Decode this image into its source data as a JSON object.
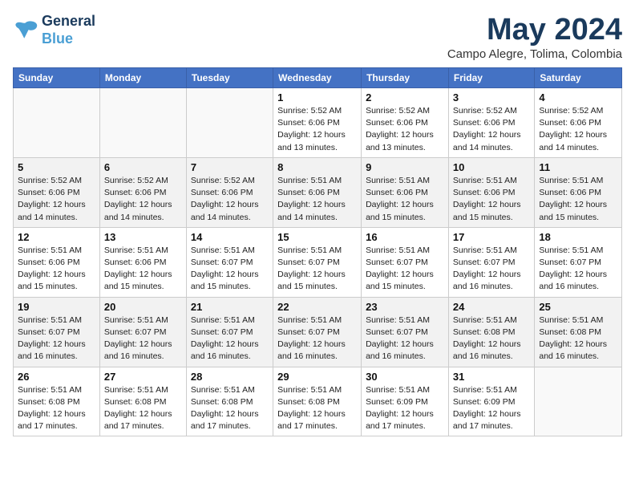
{
  "header": {
    "logo_line1": "General",
    "logo_line2": "Blue",
    "month_title": "May 2024",
    "location": "Campo Alegre, Tolima, Colombia"
  },
  "weekdays": [
    "Sunday",
    "Monday",
    "Tuesday",
    "Wednesday",
    "Thursday",
    "Friday",
    "Saturday"
  ],
  "weeks": [
    [
      {
        "day": "",
        "info": ""
      },
      {
        "day": "",
        "info": ""
      },
      {
        "day": "",
        "info": ""
      },
      {
        "day": "1",
        "info": "Sunrise: 5:52 AM\nSunset: 6:06 PM\nDaylight: 12 hours\nand 13 minutes."
      },
      {
        "day": "2",
        "info": "Sunrise: 5:52 AM\nSunset: 6:06 PM\nDaylight: 12 hours\nand 13 minutes."
      },
      {
        "day": "3",
        "info": "Sunrise: 5:52 AM\nSunset: 6:06 PM\nDaylight: 12 hours\nand 14 minutes."
      },
      {
        "day": "4",
        "info": "Sunrise: 5:52 AM\nSunset: 6:06 PM\nDaylight: 12 hours\nand 14 minutes."
      }
    ],
    [
      {
        "day": "5",
        "info": "Sunrise: 5:52 AM\nSunset: 6:06 PM\nDaylight: 12 hours\nand 14 minutes."
      },
      {
        "day": "6",
        "info": "Sunrise: 5:52 AM\nSunset: 6:06 PM\nDaylight: 12 hours\nand 14 minutes."
      },
      {
        "day": "7",
        "info": "Sunrise: 5:52 AM\nSunset: 6:06 PM\nDaylight: 12 hours\nand 14 minutes."
      },
      {
        "day": "8",
        "info": "Sunrise: 5:51 AM\nSunset: 6:06 PM\nDaylight: 12 hours\nand 14 minutes."
      },
      {
        "day": "9",
        "info": "Sunrise: 5:51 AM\nSunset: 6:06 PM\nDaylight: 12 hours\nand 15 minutes."
      },
      {
        "day": "10",
        "info": "Sunrise: 5:51 AM\nSunset: 6:06 PM\nDaylight: 12 hours\nand 15 minutes."
      },
      {
        "day": "11",
        "info": "Sunrise: 5:51 AM\nSunset: 6:06 PM\nDaylight: 12 hours\nand 15 minutes."
      }
    ],
    [
      {
        "day": "12",
        "info": "Sunrise: 5:51 AM\nSunset: 6:06 PM\nDaylight: 12 hours\nand 15 minutes."
      },
      {
        "day": "13",
        "info": "Sunrise: 5:51 AM\nSunset: 6:06 PM\nDaylight: 12 hours\nand 15 minutes."
      },
      {
        "day": "14",
        "info": "Sunrise: 5:51 AM\nSunset: 6:07 PM\nDaylight: 12 hours\nand 15 minutes."
      },
      {
        "day": "15",
        "info": "Sunrise: 5:51 AM\nSunset: 6:07 PM\nDaylight: 12 hours\nand 15 minutes."
      },
      {
        "day": "16",
        "info": "Sunrise: 5:51 AM\nSunset: 6:07 PM\nDaylight: 12 hours\nand 15 minutes."
      },
      {
        "day": "17",
        "info": "Sunrise: 5:51 AM\nSunset: 6:07 PM\nDaylight: 12 hours\nand 16 minutes."
      },
      {
        "day": "18",
        "info": "Sunrise: 5:51 AM\nSunset: 6:07 PM\nDaylight: 12 hours\nand 16 minutes."
      }
    ],
    [
      {
        "day": "19",
        "info": "Sunrise: 5:51 AM\nSunset: 6:07 PM\nDaylight: 12 hours\nand 16 minutes."
      },
      {
        "day": "20",
        "info": "Sunrise: 5:51 AM\nSunset: 6:07 PM\nDaylight: 12 hours\nand 16 minutes."
      },
      {
        "day": "21",
        "info": "Sunrise: 5:51 AM\nSunset: 6:07 PM\nDaylight: 12 hours\nand 16 minutes."
      },
      {
        "day": "22",
        "info": "Sunrise: 5:51 AM\nSunset: 6:07 PM\nDaylight: 12 hours\nand 16 minutes."
      },
      {
        "day": "23",
        "info": "Sunrise: 5:51 AM\nSunset: 6:07 PM\nDaylight: 12 hours\nand 16 minutes."
      },
      {
        "day": "24",
        "info": "Sunrise: 5:51 AM\nSunset: 6:08 PM\nDaylight: 12 hours\nand 16 minutes."
      },
      {
        "day": "25",
        "info": "Sunrise: 5:51 AM\nSunset: 6:08 PM\nDaylight: 12 hours\nand 16 minutes."
      }
    ],
    [
      {
        "day": "26",
        "info": "Sunrise: 5:51 AM\nSunset: 6:08 PM\nDaylight: 12 hours\nand 17 minutes."
      },
      {
        "day": "27",
        "info": "Sunrise: 5:51 AM\nSunset: 6:08 PM\nDaylight: 12 hours\nand 17 minutes."
      },
      {
        "day": "28",
        "info": "Sunrise: 5:51 AM\nSunset: 6:08 PM\nDaylight: 12 hours\nand 17 minutes."
      },
      {
        "day": "29",
        "info": "Sunrise: 5:51 AM\nSunset: 6:08 PM\nDaylight: 12 hours\nand 17 minutes."
      },
      {
        "day": "30",
        "info": "Sunrise: 5:51 AM\nSunset: 6:09 PM\nDaylight: 12 hours\nand 17 minutes."
      },
      {
        "day": "31",
        "info": "Sunrise: 5:51 AM\nSunset: 6:09 PM\nDaylight: 12 hours\nand 17 minutes."
      },
      {
        "day": "",
        "info": ""
      }
    ]
  ]
}
